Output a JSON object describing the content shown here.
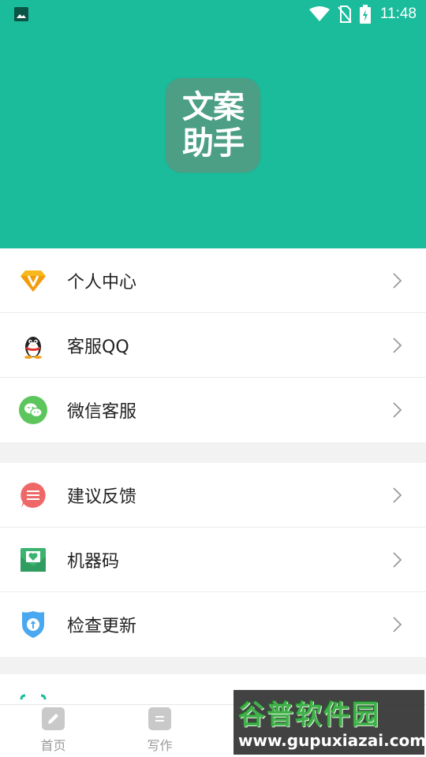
{
  "status_bar": {
    "time": "11:48",
    "icons": [
      "gallery-icon",
      "wifi-icon",
      "no-sim-icon",
      "battery-charging-icon"
    ]
  },
  "header": {
    "logo_line1": "文案",
    "logo_line2": "助手",
    "background_color": "#1abc9c"
  },
  "menu": {
    "group1": [
      {
        "label": "个人中心",
        "icon": "vip-diamond-icon"
      },
      {
        "label": "客服QQ",
        "icon": "qq-penguin-icon"
      },
      {
        "label": "微信客服",
        "icon": "wechat-icon"
      }
    ],
    "group2": [
      {
        "label": "建议反馈",
        "icon": "feedback-icon"
      },
      {
        "label": "机器码",
        "icon": "machine-code-icon"
      },
      {
        "label": "检查更新",
        "icon": "check-update-icon"
      }
    ]
  },
  "tabbar": {
    "tabs": [
      {
        "label": "首页",
        "icon": "edit-icon"
      },
      {
        "label": "写作",
        "icon": "document-icon"
      }
    ]
  },
  "watermark": {
    "title": "谷普软件园",
    "url": "www.gupuxiazai.com"
  }
}
